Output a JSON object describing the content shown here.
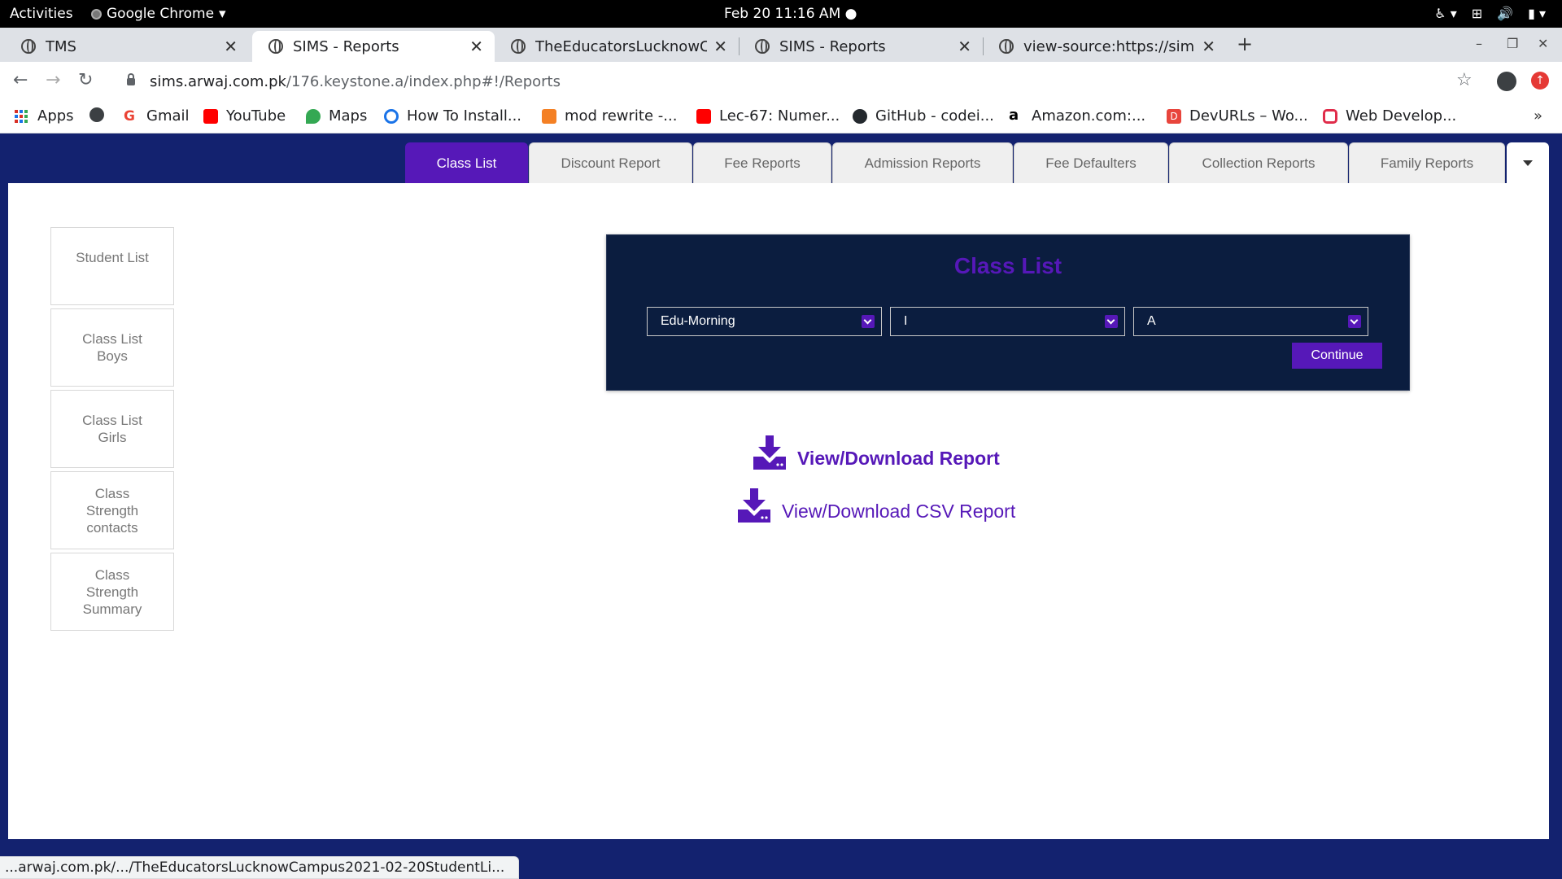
{
  "system_bar": {
    "activities": "Activities",
    "app_name": "Google Chrome",
    "clock": "Feb 20  11:16 AM"
  },
  "browser": {
    "tabs": [
      {
        "title": "TMS",
        "active": false
      },
      {
        "title": "SIMS - Reports",
        "active": true
      },
      {
        "title": "TheEducatorsLucknowCa",
        "active": false
      },
      {
        "title": "SIMS - Reports",
        "active": false
      },
      {
        "title": "view-source:https://sims.a",
        "active": false
      }
    ],
    "url_host": "sims.arwaj.com.pk",
    "url_path": "/176.keystone.a/index.php#!/Reports",
    "bookmarks": [
      "Apps",
      "",
      "Gmail",
      "YouTube",
      "Maps",
      "How To Install...",
      "mod rewrite -...",
      "Lec-67: Numer...",
      "GitHub - codei...",
      "Amazon.com:...",
      "DevURLs – Wo...",
      "Web Develop..."
    ],
    "status_url": "...arwaj.com.pk/.../TheEducatorsLucknowCampus2021-02-20StudentLi..."
  },
  "reports_nav": {
    "tabs": [
      {
        "label": "Class List",
        "active": true
      },
      {
        "label": "Discount Report",
        "active": false
      },
      {
        "label": "Fee Reports",
        "active": false
      },
      {
        "label": "Admission Reports",
        "active": false
      },
      {
        "label": "Fee Defaulters",
        "active": false
      },
      {
        "label": "Collection Reports",
        "active": false
      },
      {
        "label": "Family Reports",
        "active": false
      }
    ]
  },
  "sidebar": {
    "items": [
      {
        "label": "Student List"
      },
      {
        "label": "Class List\nBoys"
      },
      {
        "label": "Class List\nGirls"
      },
      {
        "label": "Class\nStrength\ncontacts"
      },
      {
        "label": "Class\nStrength\nSummary"
      }
    ]
  },
  "panel": {
    "title": "Class List",
    "selects": [
      {
        "value": "Edu-Morning"
      },
      {
        "value": "I"
      },
      {
        "value": "A"
      }
    ],
    "continue_label": "Continue"
  },
  "downloads": {
    "report_label": "View/Download Report",
    "csv_label": "View/Download CSV Report"
  },
  "colors": {
    "accent": "#5618b8",
    "page_bg": "#13226f",
    "panel_bg": "#0b1d3f"
  }
}
